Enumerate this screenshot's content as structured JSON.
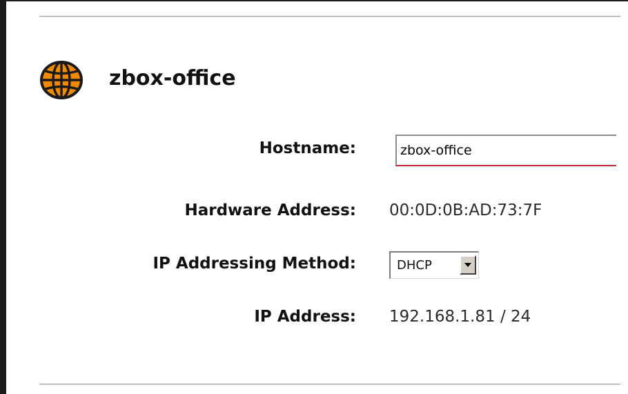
{
  "device": {
    "name": "zbox-office",
    "icon": "globe-icon",
    "icon_color": "#f28a00"
  },
  "fields": {
    "hostname": {
      "label": "Hostname:",
      "value": "zbox-office"
    },
    "hardware_address": {
      "label": "Hardware Address:",
      "value": "00:0D:0B:AD:73:7F"
    },
    "ip_method": {
      "label": "IP Addressing Method:",
      "selected": "DHCP"
    },
    "ip_address": {
      "label": "IP Address:",
      "value": "192.168.1.81 / 24"
    }
  },
  "colors": {
    "input_focus_underline": "#c0283a"
  }
}
